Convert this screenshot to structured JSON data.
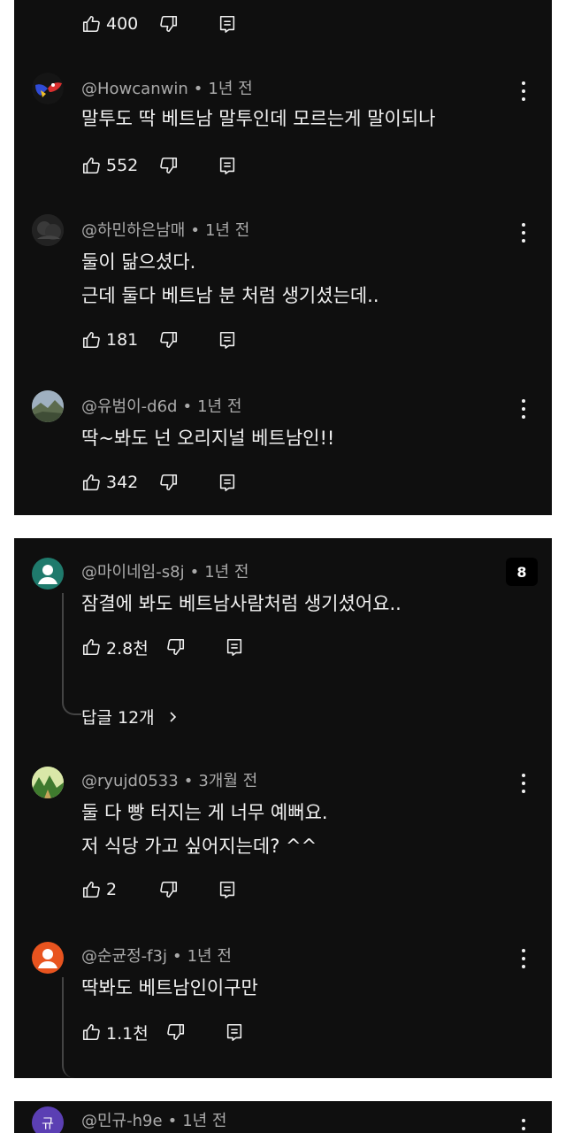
{
  "panel1": {
    "top_actions": {
      "likes": "400"
    },
    "comments": [
      {
        "handle": "@Howcanwin",
        "time": "1년 전",
        "lines": [
          "말투도 딱 베트남 말투인데 모르는게 말이되나"
        ],
        "likes": "552"
      },
      {
        "handle": "@하민하은남매",
        "time": "1년 전",
        "lines": [
          "둘이 닮으셨다.",
          "근데 둘다 베트남  분  처럼 생기셨는데.."
        ],
        "likes": "181"
      },
      {
        "handle": "@유범이-d6d",
        "time": "1년 전",
        "lines": [
          "딱~봐도 넌 오리지널 베트남인!!"
        ],
        "likes": "342"
      }
    ]
  },
  "panel2": {
    "comments": [
      {
        "handle": "@마이네임-s8j",
        "time": "1년 전",
        "lines": [
          "잠결에 봐도 베트남사람처럼 생기셨어요.."
        ],
        "likes": "2.8천",
        "badge": "8",
        "replies_label": "답글 12개"
      },
      {
        "handle": "@ryujd0533",
        "time": "3개월 전",
        "lines": [
          "둘 다 빵 터지는 게 너무 예뻐요.",
          "저 식당 가고 싶어지는데? ^^"
        ],
        "likes": "2"
      },
      {
        "handle": "@순균정-f3j",
        "time": "1년 전",
        "lines": [
          "딱봐도 베트남인이구만"
        ],
        "likes": "1.1천"
      }
    ]
  },
  "panel3": {
    "comments": [
      {
        "handle": "@민규-h9e",
        "time": "1년 전",
        "avatar_letter": "규"
      }
    ]
  },
  "icons": [
    "thumbs-up-icon",
    "thumbs-down-icon",
    "reply-icon",
    "more-vert-icon",
    "person-icon",
    "chevron-right-icon"
  ],
  "colors": {
    "background": "#0f0f0f",
    "text": "#f1f1f1",
    "meta": "#aaaaaa",
    "avatar_teal": "#1f7a6c",
    "avatar_orange": "#e8541f",
    "avatar_purple": "#5b3fb3"
  }
}
